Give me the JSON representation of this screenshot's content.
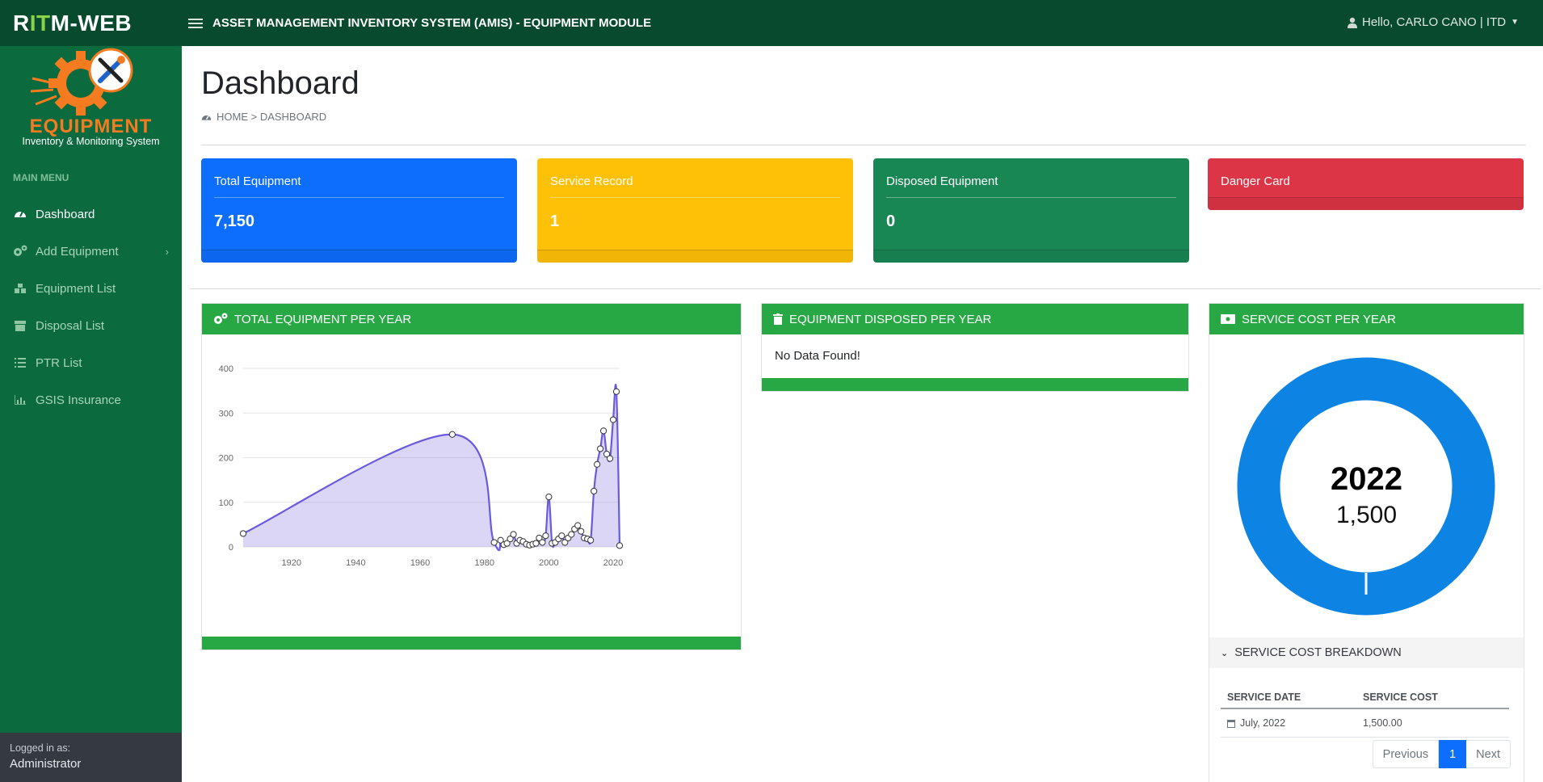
{
  "app": {
    "brand_prefix": "R",
    "brand_highlight": "IT",
    "brand_suffix": "M-WEB",
    "title": "ASSET MANAGEMENT INVENTORY SYSTEM (AMIS) - EQUIPMENT MODULE",
    "user_greeting": "Hello, CARLO CANO | ITD"
  },
  "sidebar": {
    "logo_word": "EQUIPMENT",
    "logo_subtitle": "Inventory & Monitoring System",
    "menu_header": "MAIN MENU",
    "items": [
      {
        "label": "Dashboard",
        "icon": "tachometer-icon",
        "active": true
      },
      {
        "label": "Add Equipment",
        "icon": "cogs-icon",
        "has_children": true
      },
      {
        "label": "Equipment List",
        "icon": "boxes-icon"
      },
      {
        "label": "Disposal List",
        "icon": "archive-icon"
      },
      {
        "label": "PTR List",
        "icon": "list-icon"
      },
      {
        "label": "GSIS Insurance",
        "icon": "chart-bar-icon"
      }
    ],
    "logged_in_label": "Logged in as:",
    "logged_in_user": "Administrator"
  },
  "page": {
    "title": "Dashboard",
    "breadcrumb": "HOME > DASHBOARD"
  },
  "cards": [
    {
      "title": "Total Equipment",
      "value": "7,150",
      "color": "#0d6efd"
    },
    {
      "title": "Service Record",
      "value": "1",
      "color": "#ffc107"
    },
    {
      "title": "Disposed Equipment",
      "value": "0",
      "color": "#198754"
    },
    {
      "title": "Danger Card",
      "value": "",
      "color": "#dc3545"
    }
  ],
  "panels": {
    "total_per_year": {
      "title": "TOTAL EQUIPMENT PER YEAR",
      "icon": "cogs-icon"
    },
    "disposed_per_year": {
      "title": "EQUIPMENT DISPOSED PER YEAR",
      "icon": "trash-icon",
      "empty_text": "No Data Found!"
    },
    "service_cost": {
      "title": "SERVICE COST PER YEAR",
      "icon": "money-bill-icon",
      "donut_year": "2022",
      "donut_value": "1,500",
      "donut_color": "#0d84e3"
    }
  },
  "breakdown": {
    "title": "SERVICE COST BREAKDOWN",
    "columns": [
      "SERVICE DATE",
      "SERVICE COST"
    ],
    "rows": [
      [
        "July, 2022",
        "1,500.00"
      ]
    ],
    "pager": {
      "prev": "Previous",
      "page": "1",
      "next": "Next"
    }
  },
  "chart_data": {
    "type": "area",
    "series": [
      {
        "color": "#6a5ae0",
        "x": [
          1905,
          1970,
          1983,
          1985,
          1986,
          1987,
          1988,
          1989,
          1990,
          1991,
          1992,
          1993,
          1994,
          1995,
          1996,
          1997,
          1998,
          1999,
          2000,
          2001,
          2002,
          2003,
          2004,
          2005,
          2006,
          2007,
          2008,
          2009,
          2010,
          2011,
          2012,
          2013,
          2014,
          2015,
          2016,
          2017,
          2018,
          2019,
          2020,
          2021,
          2022
        ],
        "y": [
          30,
          252,
          10,
          15,
          5,
          8,
          18,
          28,
          8,
          15,
          12,
          6,
          4,
          6,
          8,
          20,
          10,
          25,
          112,
          8,
          10,
          18,
          25,
          10,
          20,
          28,
          40,
          48,
          35,
          20,
          18,
          15,
          125,
          185,
          220,
          260,
          208,
          198,
          285,
          348,
          3
        ]
      }
    ],
    "xticks": [
      "1920",
      "1940",
      "1960",
      "1980",
      "2000",
      "2020"
    ],
    "yticks": [
      "0",
      "100",
      "200",
      "300",
      "400"
    ],
    "xlim": [
      1905,
      2022
    ],
    "ylim": [
      0,
      400
    ],
    "grid": true
  }
}
